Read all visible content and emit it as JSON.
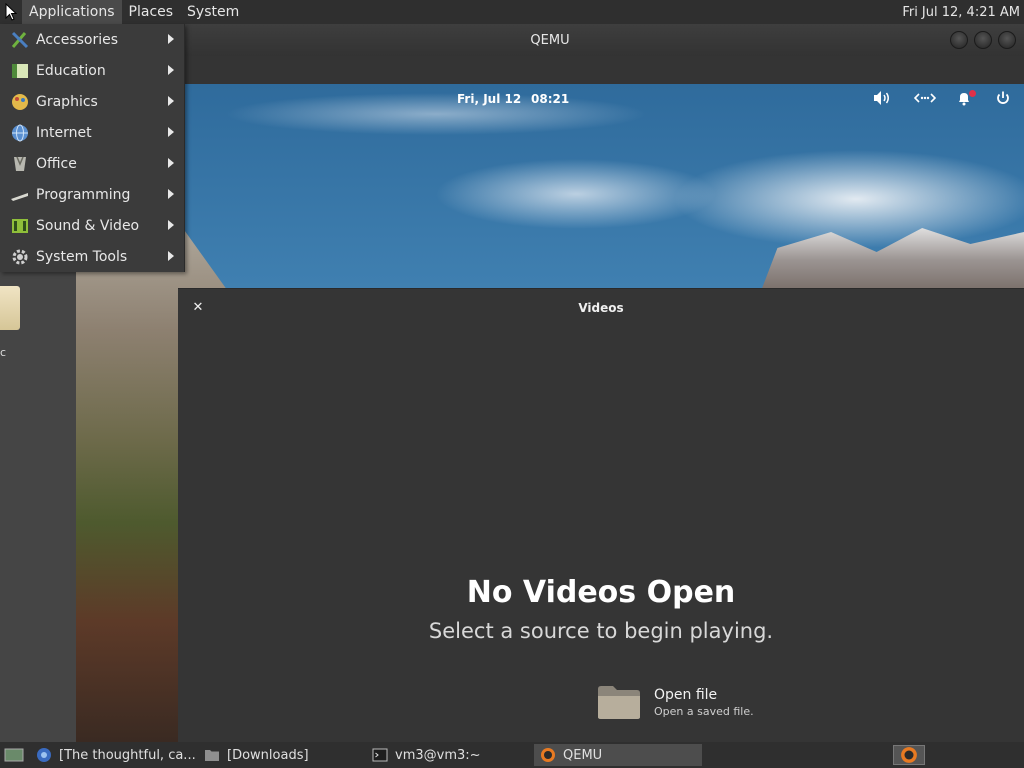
{
  "top_panel": {
    "menus": [
      "Applications",
      "Places",
      "System"
    ],
    "clock": "Fri Jul 12,  4:21 AM"
  },
  "apps_menu": {
    "items": [
      {
        "label": "Accessories",
        "icon": "accessories-icon"
      },
      {
        "label": "Education",
        "icon": "education-icon"
      },
      {
        "label": "Graphics",
        "icon": "graphics-icon"
      },
      {
        "label": "Internet",
        "icon": "internet-icon"
      },
      {
        "label": "Office",
        "icon": "office-icon"
      },
      {
        "label": "Programming",
        "icon": "programming-icon"
      },
      {
        "label": "Sound & Video",
        "icon": "sound-video-icon"
      },
      {
        "label": "System Tools",
        "icon": "system-tools-icon"
      }
    ]
  },
  "host_desktop": {
    "file_label": "c"
  },
  "qemu": {
    "title": "QEMU"
  },
  "guest": {
    "date": "Fri, Jul 12",
    "time": "08:21",
    "tray": [
      "volume-icon",
      "network-icon",
      "notifications-icon",
      "power-icon"
    ]
  },
  "videos": {
    "title": "Videos",
    "empty_title": "No Videos Open",
    "empty_subtitle": "Select a source to begin playing.",
    "open_file_label": "Open file",
    "open_file_desc": "Open a saved file."
  },
  "taskbar": {
    "items": [
      {
        "label": "[The thoughtful, ca...",
        "icon": "browser-icon"
      },
      {
        "label": "[Downloads]",
        "icon": "folder-icon"
      },
      {
        "label": "vm3@vm3:~",
        "icon": "terminal-icon"
      },
      {
        "label": "QEMU",
        "icon": "qemu-icon"
      }
    ]
  },
  "colors": {
    "panel_bg": "#2f2f2f",
    "menu_bg": "#3b3b3b",
    "videos_bg": "#353535",
    "notification_dot": "#e0304a"
  }
}
